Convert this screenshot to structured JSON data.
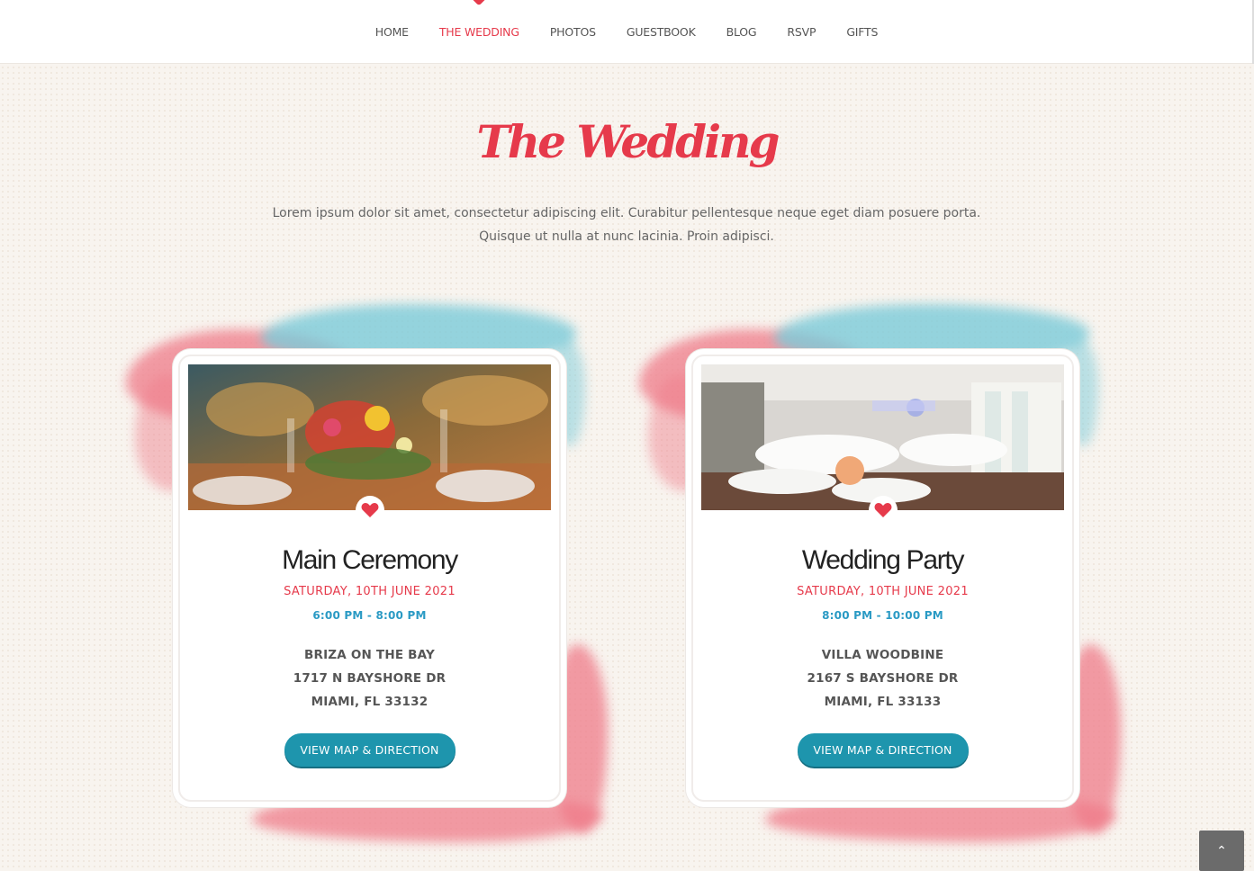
{
  "nav": {
    "items": [
      {
        "label": "HOME"
      },
      {
        "label": "THE WEDDING",
        "active": true
      },
      {
        "label": "PHOTOS"
      },
      {
        "label": "GUESTBOOK"
      },
      {
        "label": "BLOG"
      },
      {
        "label": "RSVP"
      },
      {
        "label": "GIFTS"
      }
    ]
  },
  "section": {
    "title": "The Wedding",
    "intro_line1": "Lorem ipsum dolor sit amet, consectetur adipiscing elit. Curabitur pellentesque neque eget diam posuere porta.",
    "intro_line2": "Quisque ut nulla at nunc lacinia. Proin adipisci."
  },
  "events": [
    {
      "title": "Main Ceremony",
      "date": "SATURDAY, 10TH JUNE 2021",
      "time": "6:00 PM - 8:00 PM",
      "venue": "BRIZA ON THE BAY",
      "street": "1717 N BAYSHORE DR",
      "city": "MIAMI, FL 33132",
      "button": "VIEW MAP & DIRECTION"
    },
    {
      "title": "Wedding Party",
      "date": "SATURDAY, 10TH JUNE 2021",
      "time": "8:00 PM - 10:00 PM",
      "venue": "VILLA WOODBINE",
      "street": "2167 S BAYSHORE DR",
      "city": "MIAMI, FL 33133",
      "button": "VIEW MAP & DIRECTION"
    }
  ],
  "colors": {
    "accent": "#e63a4b",
    "button": "#1e95ad",
    "time": "#2a9ac4",
    "wash_blue": "#7ccbd9",
    "wash_pink": "#ef7b89"
  },
  "icons": {
    "card_badge": "heart-icon",
    "back_to_top": "chevron-up-icon"
  }
}
